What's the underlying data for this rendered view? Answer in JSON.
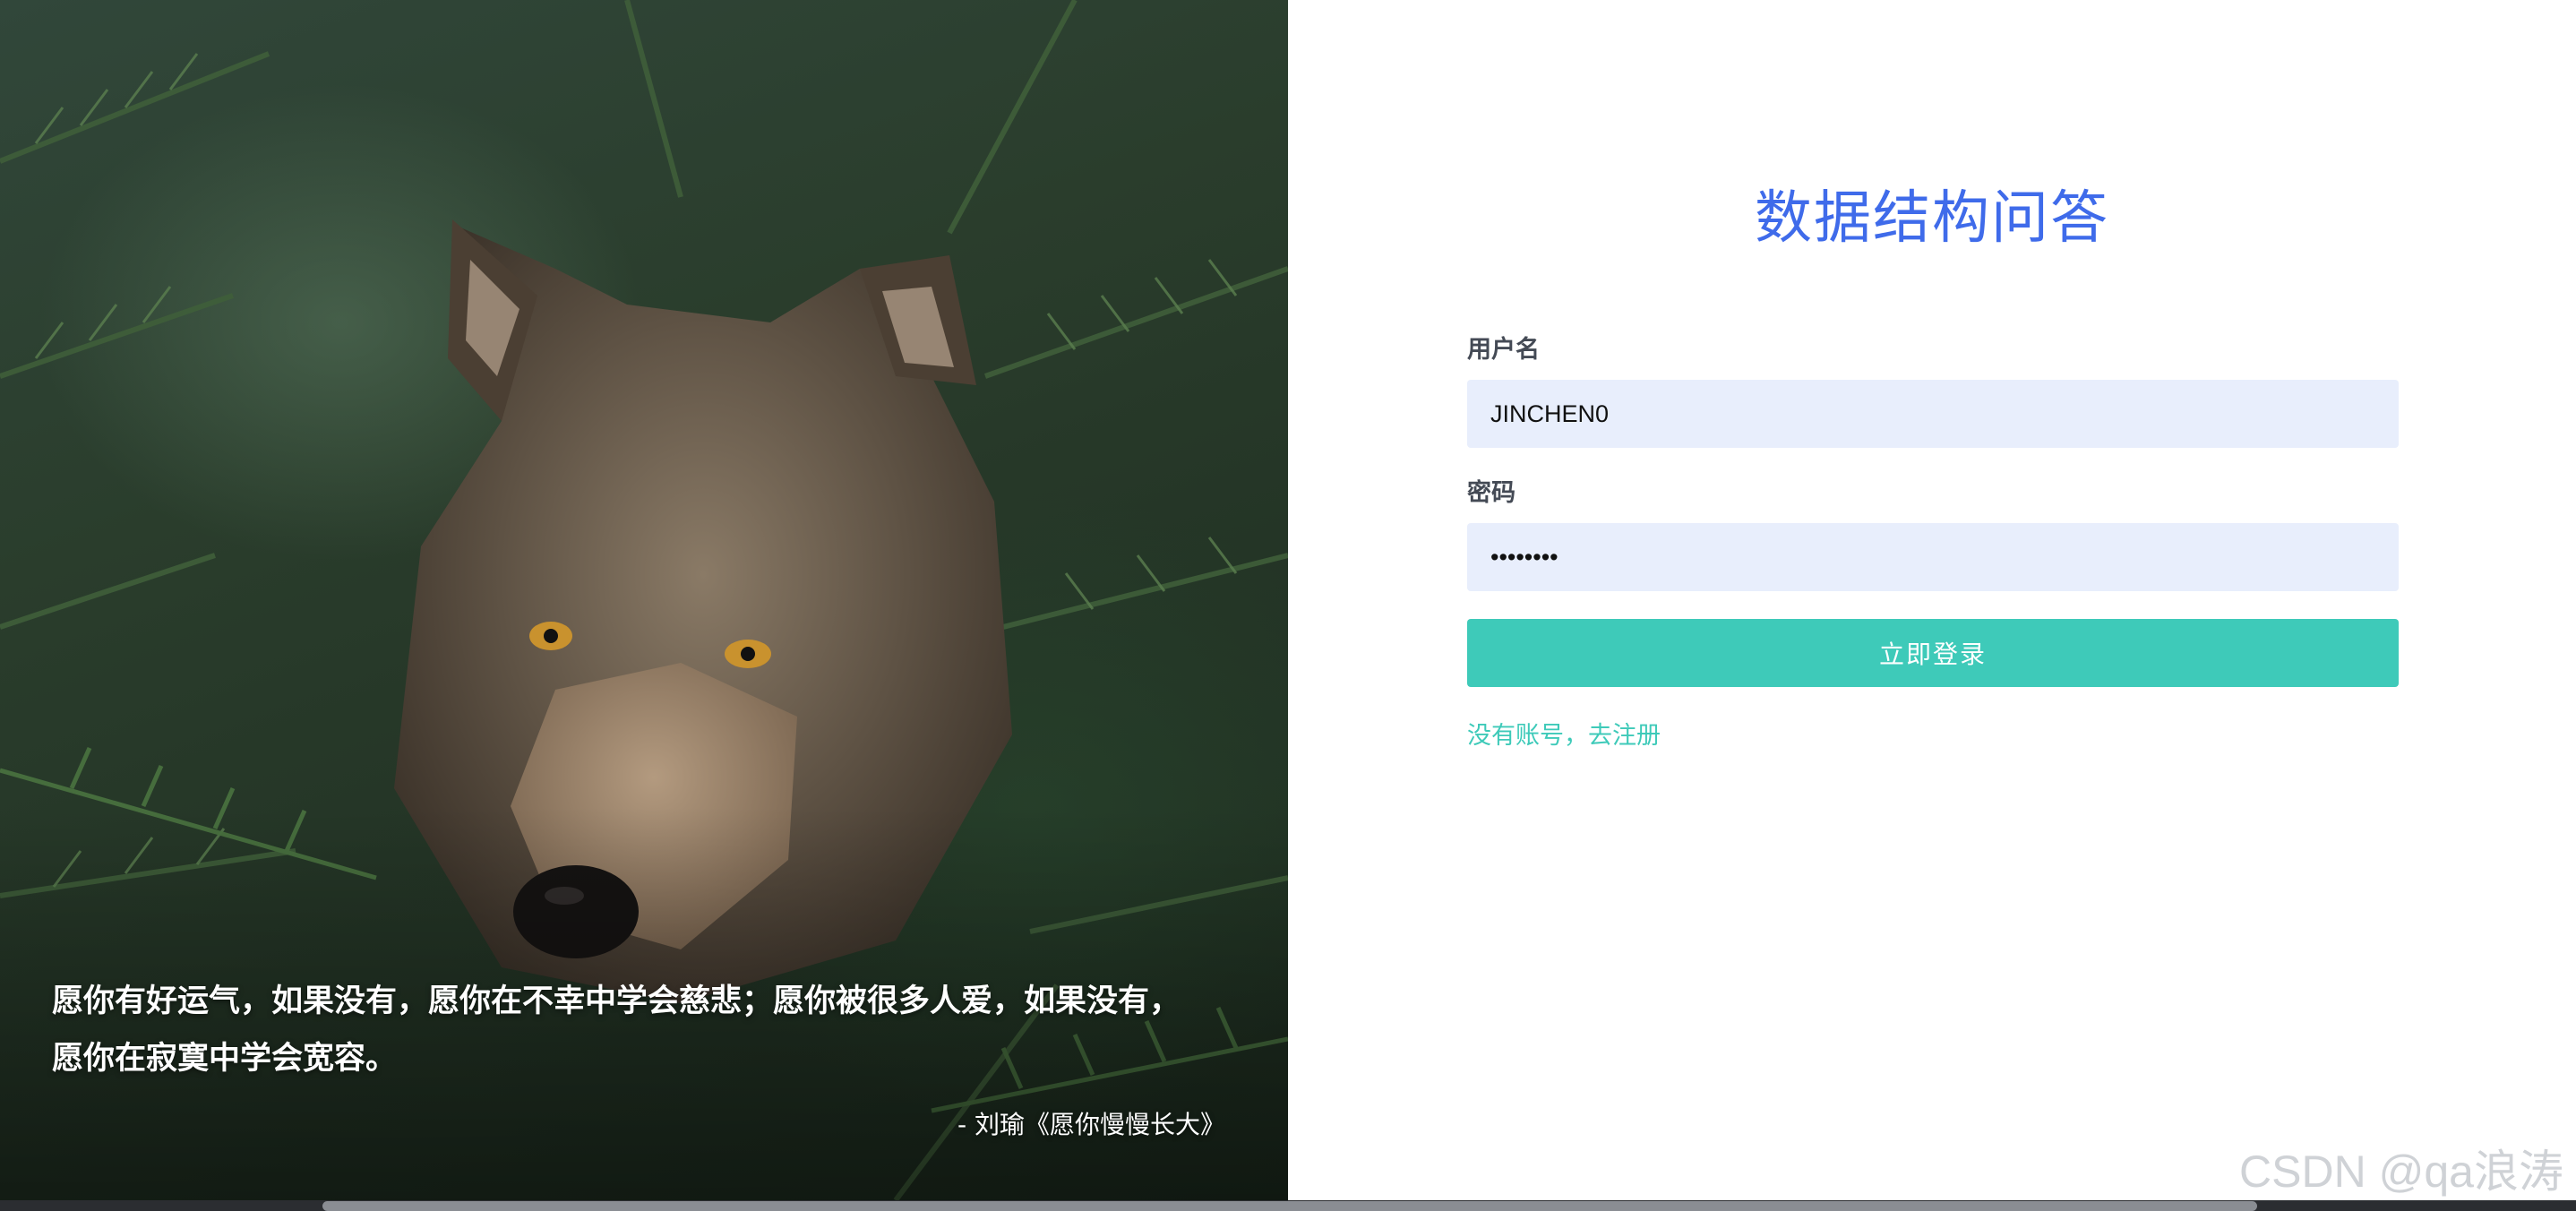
{
  "hero": {
    "quote": "愿你有好运气，如果没有，愿你在不幸中学会慈悲；愿你被很多人爱，如果没有，愿你在寂寞中学会宽容。",
    "attribution": "- 刘瑜《愿你慢慢长大》"
  },
  "login": {
    "title": "数据结构问答",
    "username_label": "用户名",
    "username_value": "JINCHEN0",
    "password_label": "密码",
    "password_value": "••••••••",
    "submit_label": "立即登录",
    "register_link": "没有账号，去注册"
  },
  "watermark": "CSDN @qa浪涛",
  "colors": {
    "title": "#3f6bea",
    "accent": "#3ecab9",
    "input_bg": "#e8eefc"
  }
}
